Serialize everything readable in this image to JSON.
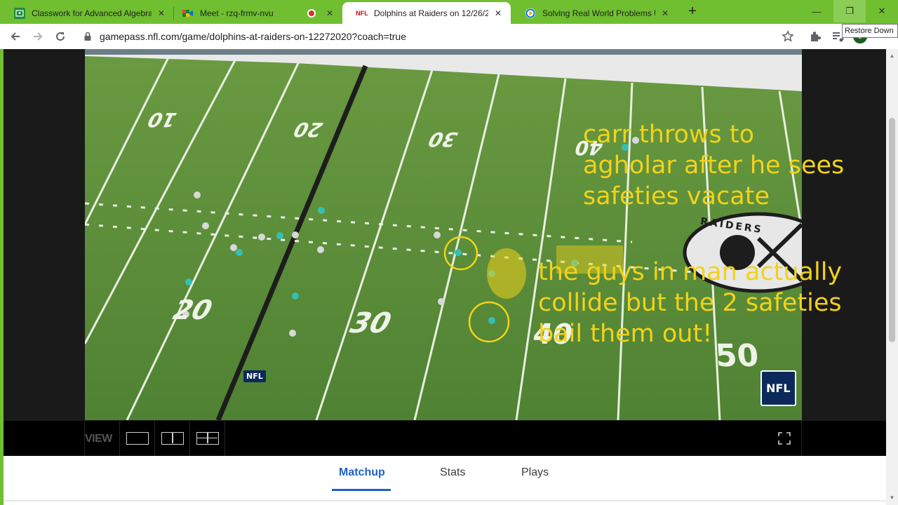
{
  "browser": {
    "tabs": [
      {
        "title": "Classwork for Advanced Algebra",
        "close": "✕"
      },
      {
        "title": "Meet - rzq-frmv-nvu",
        "close": "✕"
      },
      {
        "title": "Dolphins at Raiders on 12/26/20...",
        "close": "✕",
        "favicon_text": "NFL"
      },
      {
        "title": "Solving Real World Problems Usi...",
        "close": "✕"
      }
    ],
    "new_tab": "+",
    "window_buttons": {
      "minimize": "—",
      "restore": "❐",
      "close": "✕"
    },
    "url": "gamepass.nfl.com/game/dolphins-at-raiders-on-12272020?coach=true",
    "profile_initial": "J",
    "tooltip": "Restore Down",
    "icons": [
      "back-icon",
      "forward-icon",
      "reload-icon",
      "lock-icon",
      "star-icon",
      "extensions-icon",
      "media-control-icon"
    ]
  },
  "field": {
    "yard_numbers": [
      "10",
      "20",
      "30",
      "40",
      "20",
      "30",
      "40",
      "50"
    ],
    "logo_text": "RAIDERS",
    "nfl_logo": "NFL"
  },
  "annotations": {
    "text1": [
      "carr throws to",
      "agholar after he sees",
      "safeties vacate"
    ],
    "text2": [
      "the guys in man actually",
      "collide but the 2 safeties",
      "bail them out!"
    ]
  },
  "controls": {
    "view_label": "VIEW",
    "layouts": [
      "single-view",
      "split-view",
      "quad-view"
    ]
  },
  "page_tabs": {
    "items": [
      "Matchup",
      "Stats",
      "Plays"
    ],
    "active": "Matchup"
  },
  "colors": {
    "chrome_frame": "#6fbf30",
    "annotation": "#f2d21a",
    "field": "#5e8f3a",
    "active_tab": "#1e60c8"
  }
}
